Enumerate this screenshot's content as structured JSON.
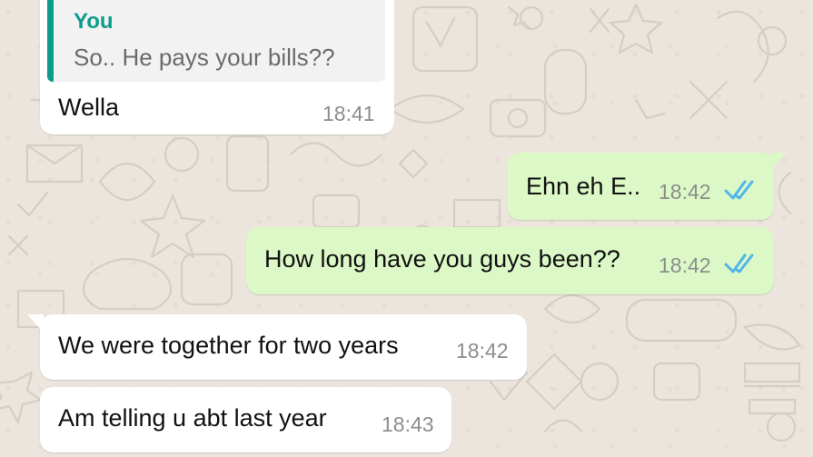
{
  "messages": [
    {
      "direction": "incoming",
      "quoted": {
        "author": "You",
        "text": "So.. He pays your bills??"
      },
      "text": "Wella",
      "time": "18:41"
    },
    {
      "direction": "outgoing",
      "text": "Ehn eh E..",
      "time": "18:42",
      "status": "read"
    },
    {
      "direction": "outgoing",
      "text": "How long have you guys been??",
      "time": "18:42",
      "status": "read"
    },
    {
      "direction": "incoming",
      "text": "We were together for two years",
      "time": "18:42"
    },
    {
      "direction": "incoming",
      "text": "Am telling u abt last year",
      "time": "18:43"
    }
  ],
  "icons": {
    "read_receipt": "double-check-icon"
  },
  "colors": {
    "wallpaper": "#ece5dd",
    "incoming_bubble": "#ffffff",
    "outgoing_bubble": "#dcf8c6",
    "quote_accent": "#0d9c8a",
    "read_tick": "#4fb6ec",
    "time_text": "#8a8f8c"
  }
}
